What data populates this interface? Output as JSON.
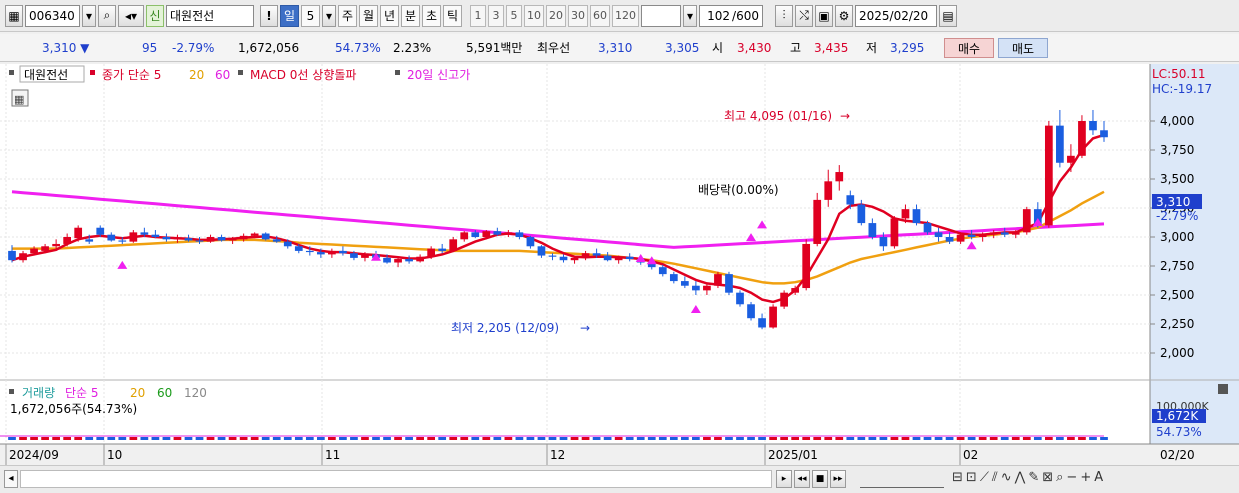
{
  "toolbar": {
    "code": "006340",
    "badge": "신",
    "name": "대원전선",
    "excl": "!",
    "periods": [
      {
        "label": "일",
        "active": true
      },
      {
        "label": "5",
        "active": false
      },
      {
        "label": "주",
        "active": false
      },
      {
        "label": "월",
        "active": false
      },
      {
        "label": "년",
        "active": false
      },
      {
        "label": "분",
        "active": false
      },
      {
        "label": "초",
        "active": false
      },
      {
        "label": "틱",
        "active": false
      }
    ],
    "intervals": [
      "1",
      "3",
      "5",
      "10",
      "20",
      "30",
      "60",
      "120"
    ],
    "count": "102",
    "count_total": "/600",
    "date": "2025/02/20"
  },
  "quote": {
    "price": "3,310",
    "change": "95",
    "rate": "-2.79%",
    "volume": "1,672,056",
    "vol_ratio": "54.73%",
    "turnover": "2.23%",
    "amount": "5,591백만",
    "best_label": "최우선",
    "best_ask": "3,310",
    "best_bid": "3,305",
    "open_label": "시",
    "open": "3,430",
    "high_label": "고",
    "high": "3,435",
    "low_label": "저",
    "low": "3,295",
    "buy_label": "매수",
    "sell_label": "매도"
  },
  "legend": {
    "name": "대원전선",
    "ma": "종가 단순 5",
    "ma20": "20",
    "ma60": "60",
    "macd": "MACD 0선 상향돌파",
    "high20": "20일 신고가"
  },
  "vol_legend": {
    "label": "거래량",
    "ma": "단순 5",
    "ma20": "20",
    "ma60": "60",
    "ma120": "120",
    "value": "1,672,056주(54.73%)"
  },
  "right_axis": {
    "lc": "LC:50.11",
    "hc": "HC:-19.17",
    "ticks": [
      "4,000",
      "3,750",
      "3,500",
      "3,250",
      "3,000",
      "2,750",
      "2,500",
      "2,250",
      "2,000"
    ],
    "cur_price": "3,310",
    "cur_rate": "-2.79%",
    "vol_max": "100,000K",
    "vol_cur": "1,672K",
    "vol_rate": "54.73%"
  },
  "annotations": {
    "high": "최고 4,095 (01/16)",
    "low": "최저 2,205 (12/09)",
    "dividend": "배당락(0.00%)"
  },
  "x_axis": {
    "labels": [
      "2024/09",
      "10",
      "11",
      "12",
      "2025/01",
      "02"
    ],
    "right": "02/20"
  },
  "chart_data": {
    "type": "candlestick",
    "ylim": [
      1850,
      4200
    ],
    "ohlc": [
      [
        2880,
        2930,
        2780,
        2800
      ],
      [
        2800,
        2880,
        2780,
        2860
      ],
      [
        2860,
        2920,
        2840,
        2900
      ],
      [
        2880,
        2940,
        2860,
        2920
      ],
      [
        2920,
        2980,
        2900,
        2940
      ],
      [
        2940,
        3030,
        2920,
        3000
      ],
      [
        2990,
        3100,
        2960,
        3080
      ],
      [
        2980,
        3020,
        2940,
        2960
      ],
      [
        3080,
        3100,
        3000,
        3020
      ],
      [
        3020,
        3040,
        2960,
        2970
      ],
      [
        2970,
        3000,
        2940,
        2960
      ],
      [
        2960,
        3060,
        2950,
        3040
      ],
      [
        3040,
        3080,
        3000,
        3020
      ],
      [
        3020,
        3060,
        2990,
        3000
      ],
      [
        3000,
        3030,
        2960,
        2980
      ],
      [
        2980,
        3020,
        2950,
        2990
      ],
      [
        2990,
        3020,
        2960,
        2970
      ],
      [
        2970,
        3000,
        2940,
        2960
      ],
      [
        2960,
        3020,
        2950,
        3000
      ],
      [
        3000,
        3020,
        2960,
        2970
      ],
      [
        2970,
        3000,
        2940,
        2980
      ],
      [
        2980,
        3030,
        2960,
        3010
      ],
      [
        3010,
        3040,
        2990,
        3030
      ],
      [
        3030,
        3040,
        2970,
        2980
      ],
      [
        2980,
        3010,
        2950,
        2960
      ],
      [
        2960,
        2980,
        2900,
        2920
      ],
      [
        2920,
        2940,
        2860,
        2880
      ],
      [
        2880,
        2920,
        2840,
        2870
      ],
      [
        2870,
        2900,
        2820,
        2850
      ],
      [
        2850,
        2900,
        2820,
        2880
      ],
      [
        2880,
        2920,
        2840,
        2860
      ],
      [
        2860,
        2880,
        2800,
        2820
      ],
      [
        2820,
        2870,
        2790,
        2850
      ],
      [
        2850,
        2880,
        2800,
        2820
      ],
      [
        2820,
        2850,
        2770,
        2780
      ],
      [
        2780,
        2830,
        2740,
        2810
      ],
      [
        2810,
        2840,
        2770,
        2790
      ],
      [
        2790,
        2850,
        2780,
        2830
      ],
      [
        2830,
        2920,
        2810,
        2900
      ],
      [
        2900,
        2940,
        2860,
        2880
      ],
      [
        2880,
        3000,
        2870,
        2980
      ],
      [
        2980,
        3050,
        2960,
        3040
      ],
      [
        3040,
        3060,
        2990,
        3000
      ],
      [
        3000,
        3060,
        2980,
        3050
      ],
      [
        3050,
        3080,
        3010,
        3020
      ],
      [
        3020,
        3060,
        3000,
        3040
      ],
      [
        3040,
        3060,
        2980,
        3000
      ],
      [
        3000,
        3010,
        2900,
        2920
      ],
      [
        2920,
        2930,
        2820,
        2840
      ],
      [
        2840,
        2860,
        2800,
        2830
      ],
      [
        2830,
        2850,
        2780,
        2800
      ],
      [
        2800,
        2840,
        2770,
        2820
      ],
      [
        2820,
        2880,
        2800,
        2860
      ],
      [
        2860,
        2900,
        2820,
        2840
      ],
      [
        2840,
        2870,
        2790,
        2800
      ],
      [
        2800,
        2840,
        2770,
        2830
      ],
      [
        2830,
        2860,
        2790,
        2810
      ],
      [
        2810,
        2830,
        2760,
        2780
      ],
      [
        2780,
        2800,
        2720,
        2740
      ],
      [
        2740,
        2760,
        2660,
        2680
      ],
      [
        2680,
        2700,
        2600,
        2620
      ],
      [
        2620,
        2660,
        2560,
        2580
      ],
      [
        2580,
        2620,
        2500,
        2540
      ],
      [
        2540,
        2600,
        2500,
        2580
      ],
      [
        2580,
        2700,
        2560,
        2680
      ],
      [
        2680,
        2700,
        2500,
        2520
      ],
      [
        2520,
        2540,
        2400,
        2420
      ],
      [
        2420,
        2440,
        2280,
        2300
      ],
      [
        2300,
        2340,
        2205,
        2220
      ],
      [
        2220,
        2420,
        2210,
        2400
      ],
      [
        2400,
        2540,
        2380,
        2520
      ],
      [
        2520,
        2580,
        2500,
        2560
      ],
      [
        2560,
        2980,
        2540,
        2940
      ],
      [
        2940,
        3380,
        2920,
        3320
      ],
      [
        3320,
        3580,
        3260,
        3480
      ],
      [
        3480,
        3620,
        3400,
        3560
      ],
      [
        3360,
        3400,
        3240,
        3280
      ],
      [
        3280,
        3320,
        3100,
        3120
      ],
      [
        3120,
        3160,
        2980,
        3000
      ],
      [
        3000,
        3040,
        2880,
        2920
      ],
      [
        2920,
        3180,
        2900,
        3160
      ],
      [
        3160,
        3280,
        3120,
        3240
      ],
      [
        3240,
        3280,
        3100,
        3120
      ],
      [
        3120,
        3140,
        3020,
        3040
      ],
      [
        3040,
        3080,
        2960,
        3000
      ],
      [
        3000,
        3040,
        2940,
        2960
      ],
      [
        2960,
        3040,
        2940,
        3020
      ],
      [
        3020,
        3060,
        2980,
        3000
      ],
      [
        3000,
        3040,
        2960,
        3020
      ],
      [
        3020,
        3060,
        2990,
        3040
      ],
      [
        3040,
        3080,
        3000,
        3020
      ],
      [
        3020,
        3060,
        2990,
        3040
      ],
      [
        3040,
        3260,
        3020,
        3240
      ],
      [
        3240,
        3300,
        3080,
        3100
      ],
      [
        3100,
        4000,
        3080,
        3960
      ],
      [
        3960,
        4095,
        3600,
        3640
      ],
      [
        3640,
        3800,
        3560,
        3700
      ],
      [
        3700,
        4050,
        3680,
        4000
      ],
      [
        4000,
        4095,
        3880,
        3920
      ],
      [
        3920,
        4000,
        3820,
        3860
      ]
    ],
    "ma5": [
      2800,
      2830,
      2850,
      2870,
      2890,
      2940,
      2980,
      3000,
      3010,
      3000,
      2990,
      3000,
      3010,
      3000,
      2995,
      2990,
      2985,
      2975,
      2975,
      2980,
      2985,
      2995,
      3000,
      3005,
      2990,
      2965,
      2930,
      2900,
      2880,
      2870,
      2870,
      2860,
      2850,
      2845,
      2835,
      2825,
      2815,
      2815,
      2830,
      2850,
      2880,
      2920,
      2960,
      2990,
      3020,
      3030,
      3020,
      2990,
      2950,
      2900,
      2860,
      2830,
      2825,
      2830,
      2830,
      2825,
      2820,
      2810,
      2790,
      2765,
      2720,
      2675,
      2630,
      2600,
      2590,
      2580,
      2560,
      2520,
      2460,
      2440,
      2470,
      2540,
      2660,
      2820,
      2980,
      3200,
      3270,
      3280,
      3260,
      3220,
      3160,
      3140,
      3130,
      3120,
      3090,
      3060,
      3030,
      3020,
      3020,
      3030,
      3040,
      3040,
      3080,
      3120,
      3300,
      3480,
      3600,
      3750,
      3850,
      3880
    ],
    "ma20": [
      2900,
      2900,
      2900,
      2900,
      2900,
      2905,
      2910,
      2915,
      2920,
      2925,
      2930,
      2935,
      2940,
      2945,
      2950,
      2955,
      2960,
      2965,
      2970,
      2975,
      2975,
      2975,
      2975,
      2970,
      2965,
      2960,
      2950,
      2945,
      2940,
      2935,
      2930,
      2925,
      2920,
      2915,
      2910,
      2905,
      2900,
      2895,
      2890,
      2885,
      2880,
      2880,
      2880,
      2880,
      2880,
      2880,
      2880,
      2875,
      2870,
      2865,
      2860,
      2855,
      2850,
      2845,
      2840,
      2830,
      2820,
      2810,
      2800,
      2785,
      2770,
      2750,
      2730,
      2710,
      2690,
      2670,
      2650,
      2630,
      2610,
      2600,
      2600,
      2610,
      2630,
      2660,
      2700,
      2740,
      2780,
      2810,
      2830,
      2850,
      2870,
      2890,
      2910,
      2930,
      2950,
      2970,
      2985,
      3000,
      3010,
      3020,
      3030,
      3040,
      3060,
      3080,
      3130,
      3180,
      3230,
      3290,
      3340,
      3390
    ]
  }
}
